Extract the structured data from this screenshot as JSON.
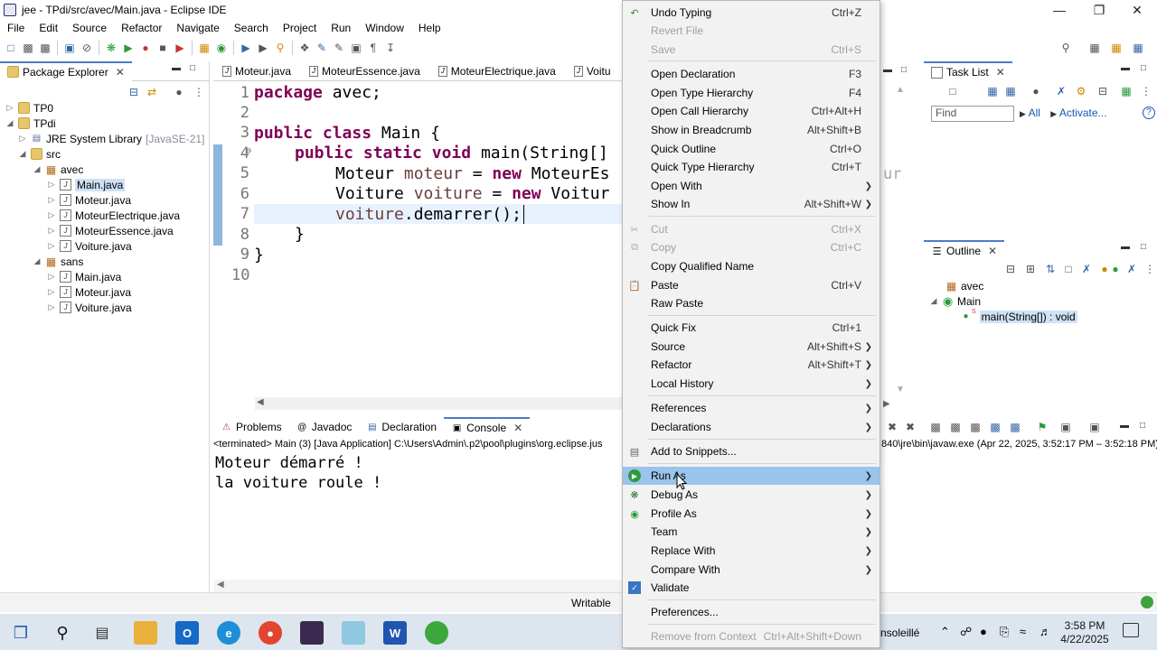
{
  "window": {
    "title": "jee - TPdi/src/avec/Main.java - Eclipse IDE"
  },
  "menubar": [
    "File",
    "Edit",
    "Source",
    "Refactor",
    "Navigate",
    "Search",
    "Project",
    "Run",
    "Window",
    "Help"
  ],
  "package_explorer": {
    "tab_label": "Package Explorer",
    "rows": [
      {
        "label": "TP0"
      },
      {
        "label": "TPdi"
      },
      {
        "label": "JRE System Library",
        "suffix": "[JavaSE-21]"
      },
      {
        "label": "src"
      },
      {
        "label": "avec"
      },
      {
        "label": "Main.java"
      },
      {
        "label": "Moteur.java"
      },
      {
        "label": "MoteurElectrique.java"
      },
      {
        "label": "MoteurEssence.java"
      },
      {
        "label": "Voiture.java"
      },
      {
        "label": "sans"
      },
      {
        "label": "Main.java"
      },
      {
        "label": "Moteur.java"
      },
      {
        "label": "Voiture.java"
      }
    ]
  },
  "editor": {
    "tabs": [
      "Moteur.java",
      "MoteurEssence.java",
      "MoteurElectrique.java",
      "Voitu"
    ],
    "line_numbers": [
      "1",
      "2",
      "3",
      "4",
      "5",
      "6",
      "7",
      "8",
      "9",
      "10"
    ],
    "code": {
      "l1_kw": "package",
      "l1_rest": " avec;",
      "l3_kw1": "public",
      "l3_kw2": "class",
      "l3_rest": " Main {",
      "l4_kw1": "public",
      "l4_kw2": "static",
      "l4_kw3": "void",
      "l4_rest": " main(String[]",
      "l5_type": "Moteur ",
      "l5_var": "moteur",
      "l5_eq": " = ",
      "l5_kw": "new",
      "l5_rest": " MoteurEs",
      "l6_type": "Voiture ",
      "l6_var": "voiture",
      "l6_eq": " = ",
      "l6_kw": "new",
      "l6_rest": " Voitur",
      "l7_var": "voiture",
      "l7_rest": ".demarrer();",
      "l8": "}",
      "l9": "}"
    },
    "fold_marker": "⊖",
    "right_fragment": "ur"
  },
  "console": {
    "tabs": [
      "Problems",
      "Javadoc",
      "Declaration",
      "Console"
    ],
    "terminated": "<terminated> Main (3) [Java Application] C:\\Users\\Admin\\.p2\\pool\\plugins\\org.eclipse.jus",
    "terminated_right": "840\\jre\\bin\\javaw.exe  (Apr 22, 2025, 3:52:17 PM – 3:52:18 PM)",
    "output": [
      "Moteur démarré !",
      "la voiture roule !"
    ]
  },
  "status_bar": {
    "mode": "Writable"
  },
  "task_list": {
    "tab_label": "Task List",
    "find_placeholder": "Find",
    "all_label": "All",
    "activate_label": "Activate..."
  },
  "outline": {
    "tab_label": "Outline",
    "items": [
      {
        "label": "avec"
      },
      {
        "label": "Main"
      },
      {
        "label": "main(String[]) : void",
        "badge": "S"
      }
    ]
  },
  "context_menu": {
    "items": [
      {
        "label": "Undo Typing",
        "shortcut": "Ctrl+Z",
        "icon": "undo-icon"
      },
      {
        "label": "Revert File",
        "disabled": true
      },
      {
        "label": "Save",
        "shortcut": "Ctrl+S",
        "disabled": true
      },
      {
        "label": "Open Declaration",
        "shortcut": "F3"
      },
      {
        "label": "Open Type Hierarchy",
        "shortcut": "F4"
      },
      {
        "label": "Open Call Hierarchy",
        "shortcut": "Ctrl+Alt+H"
      },
      {
        "label": "Show in Breadcrumb",
        "shortcut": "Alt+Shift+B"
      },
      {
        "label": "Quick Outline",
        "shortcut": "Ctrl+O"
      },
      {
        "label": "Quick Type Hierarchy",
        "shortcut": "Ctrl+T"
      },
      {
        "label": "Open With",
        "submenu": true
      },
      {
        "label": "Show In",
        "shortcut": "Alt+Shift+W",
        "submenu": true
      },
      {
        "label": "Cut",
        "shortcut": "Ctrl+X",
        "disabled": true,
        "icon": "cut-icon"
      },
      {
        "label": "Copy",
        "shortcut": "Ctrl+C",
        "disabled": true,
        "icon": "copy-icon"
      },
      {
        "label": "Copy Qualified Name"
      },
      {
        "label": "Paste",
        "shortcut": "Ctrl+V",
        "icon": "paste-icon"
      },
      {
        "label": "Raw Paste"
      },
      {
        "label": "Quick Fix",
        "shortcut": "Ctrl+1"
      },
      {
        "label": "Source",
        "shortcut": "Alt+Shift+S",
        "submenu": true
      },
      {
        "label": "Refactor",
        "shortcut": "Alt+Shift+T",
        "submenu": true
      },
      {
        "label": "Local History",
        "submenu": true
      },
      {
        "label": "References",
        "submenu": true
      },
      {
        "label": "Declarations",
        "submenu": true
      },
      {
        "label": "Add to Snippets...",
        "icon": "snippet-icon"
      },
      {
        "label": "Run As",
        "submenu": true,
        "highlighted": true,
        "icon": "run-icon"
      },
      {
        "label": "Debug As",
        "submenu": true,
        "icon": "debug-icon"
      },
      {
        "label": "Profile As",
        "submenu": true,
        "icon": "profile-icon"
      },
      {
        "label": "Team",
        "submenu": true
      },
      {
        "label": "Replace With",
        "submenu": true
      },
      {
        "label": "Compare With",
        "submenu": true
      },
      {
        "label": "Validate",
        "icon": "check-icon"
      },
      {
        "label": "Preferences..."
      },
      {
        "label": "Remove from Context",
        "shortcut": "Ctrl+Alt+Shift+Down",
        "disabled": true
      }
    ]
  },
  "taskbar": {
    "clock_time": "3:58 PM",
    "clock_date": "4/22/2025",
    "weather_fragment": "nsoleillé"
  }
}
